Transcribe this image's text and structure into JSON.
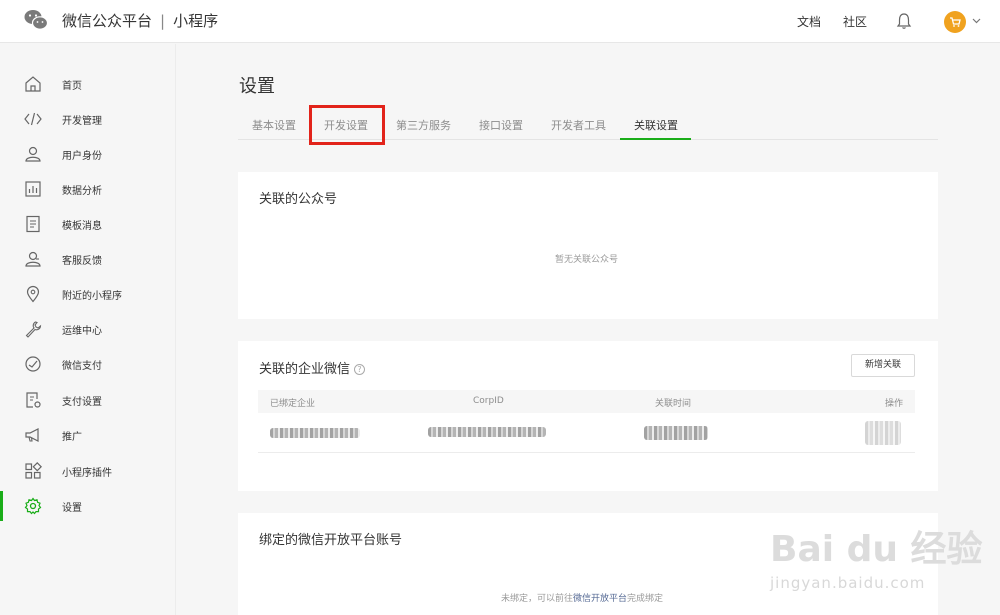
{
  "header": {
    "brand": "微信公众平台",
    "separator": "|",
    "product": "小程序",
    "docs": "文档",
    "community": "社区",
    "icons": [
      "wechat-logo-icon",
      "bell-icon",
      "cart-icon",
      "chevron-down-icon"
    ],
    "accent": "#f0a21f"
  },
  "sidebar": {
    "items": [
      {
        "label": "首页",
        "icon": "home-icon"
      },
      {
        "label": "开发管理",
        "icon": "code-icon"
      },
      {
        "label": "用户身份",
        "icon": "user-icon"
      },
      {
        "label": "数据分析",
        "icon": "chart-icon"
      },
      {
        "label": "模板消息",
        "icon": "document-icon"
      },
      {
        "label": "客服反馈",
        "icon": "support-icon"
      },
      {
        "label": "附近的小程序",
        "icon": "location-icon"
      },
      {
        "label": "运维中心",
        "icon": "wrench-icon"
      },
      {
        "label": "微信支付",
        "icon": "payment-icon"
      },
      {
        "label": "支付设置",
        "icon": "payment-settings-icon"
      },
      {
        "label": "推广",
        "icon": "megaphone-icon"
      },
      {
        "label": "小程序插件",
        "icon": "plugin-icon"
      },
      {
        "label": "设置",
        "icon": "gear-icon",
        "active": true
      }
    ],
    "active_color": "#1aad19"
  },
  "main": {
    "title": "设置",
    "tabs": [
      "基本设置",
      "开发设置",
      "第三方服务",
      "接口设置",
      "开发者工具",
      "关联设置"
    ],
    "active_tab": "关联设置",
    "highlighted_tab": "开发设置",
    "highlight_color": "#e2231a",
    "cards": {
      "official": {
        "title": "关联的公众号",
        "empty": "暂无关联公众号"
      },
      "enterprise": {
        "title": "关联的企业微信",
        "help": "?",
        "button": "新增关联",
        "columns": [
          "已绑定企业",
          "CorpID",
          "关联时间",
          "操作"
        ]
      },
      "open_platform": {
        "title": "绑定的微信开放平台账号",
        "empty_prefix": "未绑定，可以前往",
        "empty_link": "微信开放平台",
        "empty_suffix": "完成绑定"
      }
    }
  },
  "watermark": {
    "logo": "Bai du 经验",
    "url": "jingyan.baidu.com"
  }
}
